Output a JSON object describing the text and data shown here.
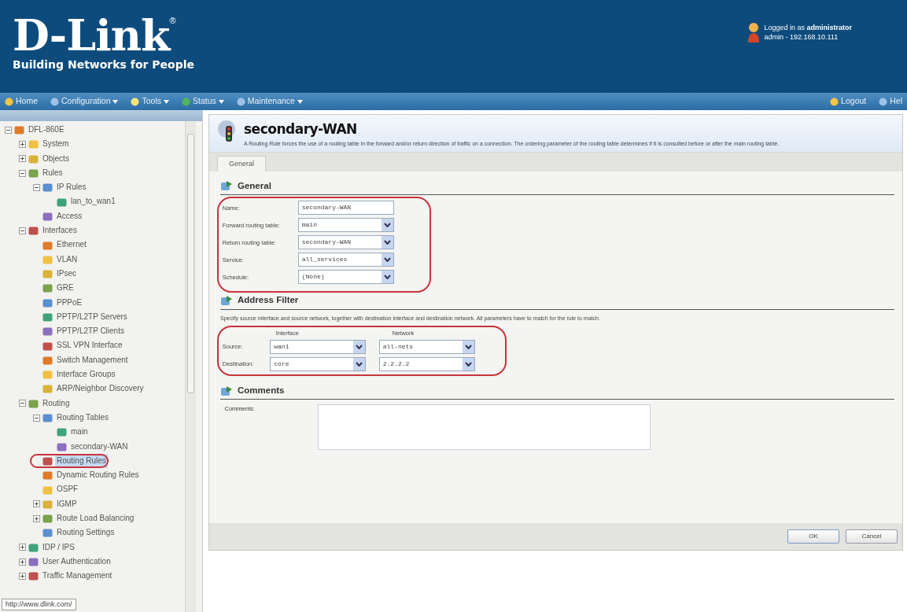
{
  "header": {
    "logo": "D-Link",
    "registered": "®",
    "tagline": "Building Networks for People",
    "login_line": "Logged in as **administrator**",
    "login_detail": "admin - 192.168.10.111"
  },
  "menu": {
    "left": [
      {
        "label": "Home",
        "dropdown": false
      },
      {
        "label": "Configuration",
        "dropdown": true
      },
      {
        "label": "Tools",
        "dropdown": true
      },
      {
        "label": "Status",
        "dropdown": true
      },
      {
        "label": "Maintenance",
        "dropdown": true
      }
    ],
    "right": [
      {
        "label": "Logout",
        "dropdown": false
      },
      {
        "label": "Hel",
        "dropdown": false
      }
    ]
  },
  "tree": [
    {
      "label": "DFL-860E",
      "expanded": true,
      "selected": false,
      "circled": false,
      "children": [
        {
          "label": "System",
          "expanded": false,
          "selected": false,
          "circled": false
        },
        {
          "label": "Objects",
          "expanded": false,
          "selected": false,
          "circled": false
        },
        {
          "label": "Rules",
          "expanded": true,
          "selected": false,
          "circled": false,
          "children": [
            {
              "label": "IP Rules",
              "expanded": true,
              "selected": false,
              "circled": false,
              "children": [
                {
                  "label": "lan_to_wan1",
                  "selected": false,
                  "circled": false
                }
              ]
            },
            {
              "label": "Access",
              "selected": false,
              "circled": false
            }
          ]
        },
        {
          "label": "Interfaces",
          "expanded": true,
          "selected": false,
          "circled": false,
          "children": [
            {
              "label": "Ethernet",
              "selected": false,
              "circled": false
            },
            {
              "label": "VLAN",
              "selected": false,
              "circled": false
            },
            {
              "label": "IPsec",
              "selected": false,
              "circled": false
            },
            {
              "label": "GRE",
              "selected": false,
              "circled": false
            },
            {
              "label": "PPPoE",
              "selected": false,
              "circled": false
            },
            {
              "label": "PPTP/L2TP Servers",
              "selected": false,
              "circled": false
            },
            {
              "label": "PPTP/L2TP Clients",
              "selected": false,
              "circled": false
            },
            {
              "label": "SSL VPN Interface",
              "selected": false,
              "circled": false
            },
            {
              "label": "Switch Management",
              "selected": false,
              "circled": false
            },
            {
              "label": "Interface Groups",
              "selected": false,
              "circled": false
            },
            {
              "label": "ARP/Neighbor Discovery",
              "selected": false,
              "circled": false
            }
          ]
        },
        {
          "label": "Routing",
          "expanded": true,
          "selected": false,
          "circled": false,
          "children": [
            {
              "label": "Routing Tables",
              "expanded": true,
              "selected": false,
              "circled": false,
              "children": [
                {
                  "label": "main",
                  "selected": false,
                  "circled": false
                },
                {
                  "label": "secondary-WAN",
                  "selected": false,
                  "circled": false
                }
              ]
            },
            {
              "label": "Routing Rules",
              "selected": true,
              "circled": true
            },
            {
              "label": "Dynamic Routing Rules",
              "selected": false,
              "circled": false
            },
            {
              "label": "OSPF",
              "selected": false,
              "circled": false
            },
            {
              "label": "IGMP",
              "expanded": false,
              "selected": false,
              "circled": false
            },
            {
              "label": "Route Load Balancing",
              "expanded": false,
              "selected": false,
              "circled": false
            },
            {
              "label": "Routing Settings",
              "selected": false,
              "circled": false
            }
          ]
        },
        {
          "label": "IDP / IPS",
          "expanded": false,
          "selected": false,
          "circled": false
        },
        {
          "label": "User Authentication",
          "expanded": false,
          "selected": false,
          "circled": false
        },
        {
          "label": "Traffic Management",
          "expanded": false,
          "selected": false,
          "circled": false
        }
      ]
    }
  ],
  "status_url": "http://www.dlink.com/",
  "page": {
    "title": "secondary-WAN",
    "description": "A Routing Rule forces the use of a routing table in the forward and/or return direction of traffic on a connection. The ordering parameter of the routing table determines if it is consulted before or after the main routing table.",
    "tabs": [
      {
        "label": "General",
        "selected": true
      }
    ]
  },
  "general": {
    "title": "General",
    "circled": true,
    "fields": [
      {
        "label": "Name:",
        "kind": "text",
        "value": "secondary-WAN"
      },
      {
        "label": "Forward routing table:",
        "kind": "select",
        "value": "main"
      },
      {
        "label": "Return routing table:",
        "kind": "select",
        "value": "secondary-WAN"
      },
      {
        "label": "Service:",
        "kind": "select",
        "value": "all_services"
      },
      {
        "label": "Schedule:",
        "kind": "select",
        "value": "(None)"
      }
    ]
  },
  "address_filter": {
    "title": "Address Filter",
    "circled": true,
    "description": "Specify source interface and source network, together with destination interface and destination network. All parameters have to match for the rule to match.",
    "columns": [
      "Interface",
      "Network"
    ],
    "rows": [
      {
        "label": "Source:",
        "interface": "wan1",
        "network": "all-nets"
      },
      {
        "label": "Destination:",
        "interface": "core",
        "network": "2.2.2.2"
      }
    ]
  },
  "comments": {
    "title": "Comments",
    "label": "Comments:"
  },
  "buttons": [
    "OK",
    "Cancel"
  ]
}
